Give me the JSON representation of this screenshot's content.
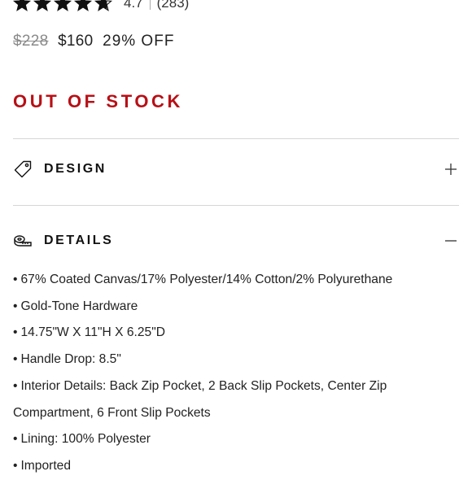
{
  "rating": {
    "stars": 4.7,
    "value": "4.7",
    "count": "(283)"
  },
  "price": {
    "original": "$228",
    "sale": "$160",
    "discount": "29% OFF"
  },
  "stock_status": "OUT OF STOCK",
  "colors": {
    "accent_red": "#b80f16",
    "text": "#222222",
    "muted": "#8a8a8a",
    "divider": "#d6d6d6"
  },
  "sections": {
    "design": {
      "title": "DESIGN",
      "icon": "tag-icon",
      "toggle_icon": "plus-icon",
      "expanded": false
    },
    "details": {
      "title": "DETAILS",
      "icon": "tape-measure-icon",
      "toggle_icon": "minus-icon",
      "expanded": true,
      "items": [
        "67% Coated Canvas/17% Polyester/14% Cotton/2% Polyurethane",
        "Gold-Tone Hardware",
        "14.75\"W X 11\"H X 6.25\"D",
        "Handle Drop: 8.5\"",
        "Interior Details: Back Zip Pocket, 2 Back Slip Pockets, Center Zip Compartment, 6 Front Slip Pockets",
        "Lining: 100% Polyester",
        "Imported"
      ]
    }
  }
}
